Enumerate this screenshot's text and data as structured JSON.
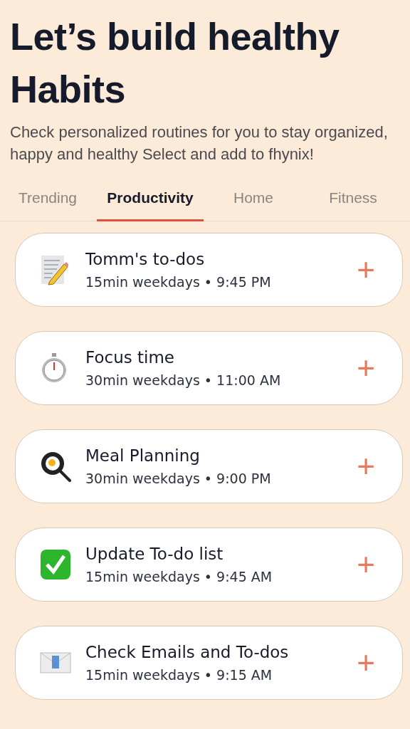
{
  "heading": {
    "title": "Let’s build healthy Habits",
    "subtitle": "Check personalized routines for you to stay organized, happy and healthy Select and add to fhynix!"
  },
  "tabs": [
    {
      "label": "Trending",
      "selected": false
    },
    {
      "label": "Productivity",
      "selected": true
    },
    {
      "label": "Home",
      "selected": false
    },
    {
      "label": "Fitness",
      "selected": false
    }
  ],
  "routines": [
    {
      "kind": "notepad",
      "title": "Tomm's to-dos",
      "schedule": "15min weekdays • 9:45 PM",
      "add": "+"
    },
    {
      "kind": "stopwatch",
      "title": "Focus time",
      "schedule": "30min weekdays • 11:00 AM",
      "add": "+"
    },
    {
      "kind": "pan",
      "title": "Meal Planning",
      "schedule": "30min weekdays • 9:00 PM",
      "add": "+"
    },
    {
      "kind": "check",
      "title": "Update To-do list",
      "schedule": "15min weekdays • 9:45 AM",
      "add": "+"
    },
    {
      "kind": "envelope",
      "title": "Check Emails and To-dos",
      "schedule": "15min weekdays • 9:15 AM",
      "add": "+"
    }
  ]
}
